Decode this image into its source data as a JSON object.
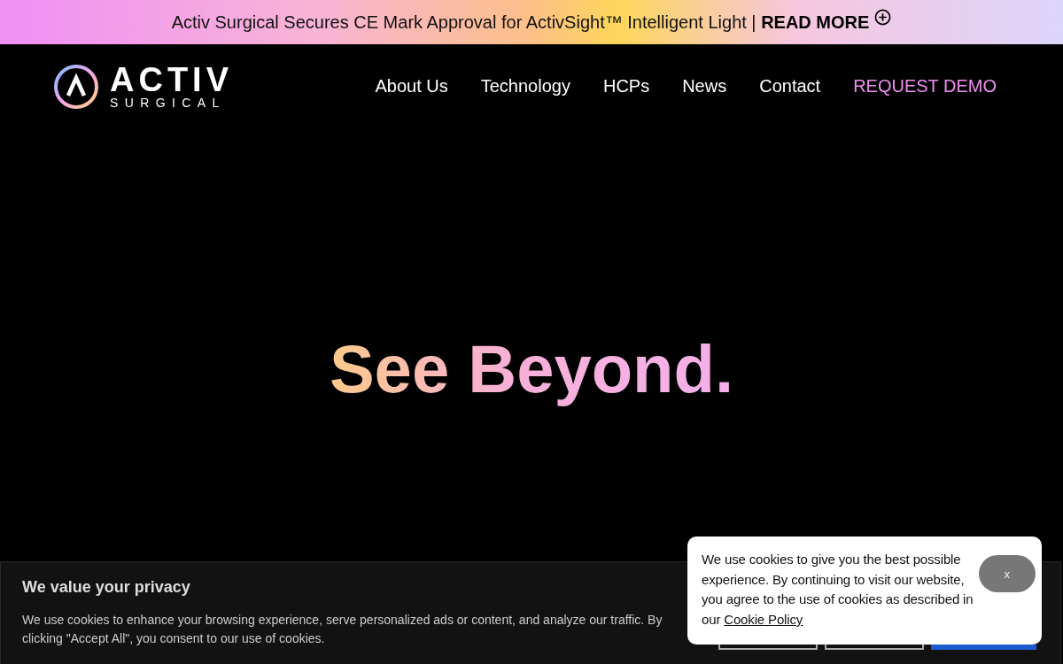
{
  "announcement": {
    "text": "Activ Surgical Secures CE Mark Approval for ActivSight™ Intelligent Light | ",
    "link": "READ MORE"
  },
  "logo": {
    "name": "ACTIV",
    "subtitle": "SURGICAL"
  },
  "nav": [
    {
      "label": "About Us",
      "kind": "link"
    },
    {
      "label": "Technology",
      "kind": "link"
    },
    {
      "label": "HCPs",
      "kind": "link"
    },
    {
      "label": "News",
      "kind": "link"
    },
    {
      "label": "Contact",
      "kind": "link"
    },
    {
      "label": "REQUEST DEMO",
      "kind": "cta"
    }
  ],
  "hero": {
    "title": "See Beyond."
  },
  "privacy_banner": {
    "title": "We value your privacy",
    "text": "We use cookies to enhance your browsing experience, serve personalized ads or content, and analyze our traffic. By clicking \"Accept All\", you consent to our use of cookies."
  },
  "cookie_popup": {
    "text": "We use cookies to give you the best possible experience. By continuing to visit our website, you agree to the use of cookies as described in our ",
    "link": "Cookie Policy",
    "close": "x"
  }
}
